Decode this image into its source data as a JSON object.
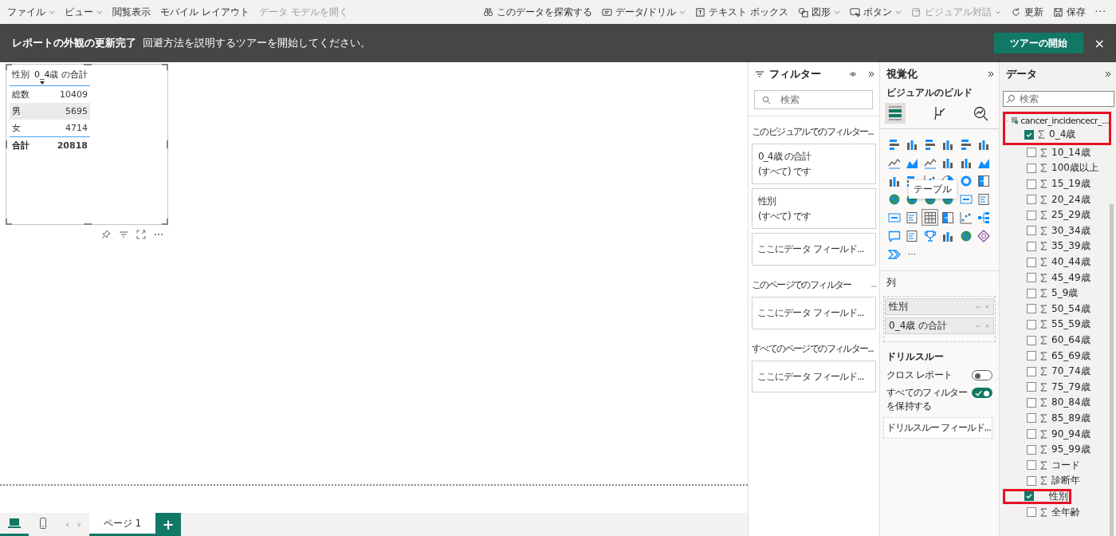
{
  "toolbar": {
    "left": [
      {
        "label": "ファイル",
        "dropdown": true,
        "disabled": false
      },
      {
        "label": "ビュー",
        "dropdown": true,
        "disabled": false
      },
      {
        "label": "閲覧表示",
        "dropdown": false,
        "disabled": false
      },
      {
        "label": "モバイル レイアウト",
        "dropdown": false,
        "disabled": false
      },
      {
        "label": "データ モデルを開く",
        "dropdown": false,
        "disabled": true
      }
    ],
    "right": [
      {
        "kind": "explore",
        "label": "このデータを探索する",
        "dropdown": false,
        "disabled": false
      },
      {
        "kind": "drill",
        "label": "データ/ドリル",
        "dropdown": true,
        "disabled": false
      },
      {
        "kind": "textbox",
        "label": "テキスト ボックス",
        "dropdown": false,
        "disabled": false
      },
      {
        "kind": "shapes",
        "label": "図形",
        "dropdown": true,
        "disabled": false
      },
      {
        "kind": "button",
        "label": "ボタン",
        "dropdown": true,
        "disabled": false
      },
      {
        "kind": "interact",
        "label": "ビジュアル対話",
        "dropdown": true,
        "disabled": true
      },
      {
        "kind": "refresh",
        "label": "更新",
        "dropdown": false,
        "disabled": false
      },
      {
        "kind": "save",
        "label": "保存",
        "dropdown": false,
        "disabled": false
      }
    ],
    "more": "···"
  },
  "banner": {
    "title": "レポートの外観の更新完了",
    "message": "回避方法を説明するツアーを開始してください。",
    "button": "ツアーの開始",
    "close": "×"
  },
  "table_visual": {
    "columns": [
      "性別",
      "0_4歳 の合計"
    ],
    "rows": [
      {
        "label": "総数",
        "value": "10409",
        "highlighted": false
      },
      {
        "label": "男",
        "value": "5695",
        "highlighted": true
      },
      {
        "label": "女",
        "value": "4714",
        "highlighted": false
      }
    ],
    "total": {
      "label": "合計",
      "value": "20818"
    }
  },
  "filters": {
    "title": "フィルター",
    "search_placeholder": "検索",
    "sections": [
      {
        "title": "このビジュアルでのフィルター...",
        "cards": [
          {
            "title": "0_4歳 の合計",
            "subtitle": "(すべて) です"
          },
          {
            "title": "性別",
            "subtitle": "(すべて) です"
          },
          {
            "placeholder": "ここにデータ フィールド..."
          }
        ]
      },
      {
        "title": "このページでのフィルター",
        "more": "...",
        "cards": [
          {
            "placeholder": "ここにデータ フィールド..."
          }
        ]
      },
      {
        "title": "すべてのページでのフィルター...",
        "cards": [
          {
            "placeholder": "ここにデータ フィールド..."
          }
        ]
      }
    ]
  },
  "visualizations": {
    "title": "視覚化",
    "subtitle": "ビジュアルのビルド",
    "modes": [
      {
        "kind": "build",
        "selected": true
      },
      {
        "kind": "format",
        "selected": false
      },
      {
        "kind": "analytics",
        "selected": false
      }
    ],
    "types": [
      {
        "kind": "stacked-bar",
        "selected": false
      },
      {
        "kind": "stacked-column",
        "selected": false
      },
      {
        "kind": "clustered-bar",
        "selected": false
      },
      {
        "kind": "clustered-column",
        "selected": false
      },
      {
        "kind": "percent-bar",
        "selected": false
      },
      {
        "kind": "percent-column",
        "selected": false
      },
      {
        "kind": "line",
        "selected": false
      },
      {
        "kind": "area",
        "selected": false
      },
      {
        "kind": "stacked-area",
        "selected": false
      },
      {
        "kind": "line-column",
        "selected": false
      },
      {
        "kind": "line-clustered",
        "selected": false
      },
      {
        "kind": "ribbon",
        "selected": false
      },
      {
        "kind": "waterfall",
        "selected": false
      },
      {
        "kind": "funnel",
        "selected": false
      },
      {
        "kind": "scatter",
        "selected": false
      },
      {
        "kind": "pie",
        "selected": false
      },
      {
        "kind": "donut",
        "selected": false
      },
      {
        "kind": "treemap",
        "selected": false
      },
      {
        "kind": "map",
        "selected": false
      },
      {
        "kind": "filled-map",
        "selected": false
      },
      {
        "kind": "shape-map",
        "selected": false
      },
      {
        "kind": "azure-map",
        "selected": false
      },
      {
        "kind": "card",
        "selected": false
      },
      {
        "kind": "multi-card",
        "selected": false
      },
      {
        "kind": "kpi",
        "selected": false
      },
      {
        "kind": "slicer",
        "selected": false
      },
      {
        "kind": "table",
        "selected": true
      },
      {
        "kind": "matrix",
        "selected": false
      },
      {
        "kind": "influencers",
        "selected": false
      },
      {
        "kind": "decomposition",
        "selected": false
      },
      {
        "kind": "qna",
        "selected": false
      },
      {
        "kind": "paginated",
        "selected": false
      },
      {
        "kind": "trophy",
        "selected": false
      },
      {
        "kind": "narrative",
        "selected": false
      },
      {
        "kind": "globe",
        "selected": false
      },
      {
        "kind": "apps",
        "selected": false
      },
      {
        "kind": "automate",
        "selected": false
      }
    ],
    "more": "···",
    "tooltip": "テーブル",
    "wells_label": "列",
    "wells": [
      "性別",
      "0_4歳 の合計"
    ],
    "drill_title": "ドリルスルー",
    "toggles": [
      {
        "label": "クロス レポート",
        "on": false
      },
      {
        "label": "すべてのフィルターを保持する",
        "on": true
      }
    ],
    "drill_placeholder": "ドリルスルー フィールド..."
  },
  "data": {
    "title": "データ",
    "search_placeholder": "検索",
    "table": {
      "name": "cancer_incidencecr_...",
      "highlighted": true,
      "expanded": true,
      "fields": [
        {
          "name": "0_4歳",
          "kind": "measure",
          "checked": true,
          "highlighted": false
        },
        {
          "name": "10_14歳",
          "kind": "measure",
          "checked": false,
          "highlighted": false
        },
        {
          "name": "100歳以上",
          "kind": "measure",
          "checked": false,
          "highlighted": false
        },
        {
          "name": "15_19歳",
          "kind": "measure",
          "checked": false,
          "highlighted": false
        },
        {
          "name": "20_24歳",
          "kind": "measure",
          "checked": false,
          "highlighted": false
        },
        {
          "name": "25_29歳",
          "kind": "measure",
          "checked": false,
          "highlighted": false
        },
        {
          "name": "30_34歳",
          "kind": "measure",
          "checked": false,
          "highlighted": false
        },
        {
          "name": "35_39歳",
          "kind": "measure",
          "checked": false,
          "highlighted": false
        },
        {
          "name": "40_44歳",
          "kind": "measure",
          "checked": false,
          "highlighted": false
        },
        {
          "name": "45_49歳",
          "kind": "measure",
          "checked": false,
          "highlighted": false
        },
        {
          "name": "5_9歳",
          "kind": "measure",
          "checked": false,
          "highlighted": false
        },
        {
          "name": "50_54歳",
          "kind": "measure",
          "checked": false,
          "highlighted": false
        },
        {
          "name": "55_59歳",
          "kind": "measure",
          "checked": false,
          "highlighted": false
        },
        {
          "name": "60_64歳",
          "kind": "measure",
          "checked": false,
          "highlighted": false
        },
        {
          "name": "65_69歳",
          "kind": "measure",
          "checked": false,
          "highlighted": false
        },
        {
          "name": "70_74歳",
          "kind": "measure",
          "checked": false,
          "highlighted": false
        },
        {
          "name": "75_79歳",
          "kind": "measure",
          "checked": false,
          "highlighted": false
        },
        {
          "name": "80_84歳",
          "kind": "measure",
          "checked": false,
          "highlighted": false
        },
        {
          "name": "85_89歳",
          "kind": "measure",
          "checked": false,
          "highlighted": false
        },
        {
          "name": "90_94歳",
          "kind": "measure",
          "checked": false,
          "highlighted": false
        },
        {
          "name": "95_99歳",
          "kind": "measure",
          "checked": false,
          "highlighted": false
        },
        {
          "name": "コード",
          "kind": "measure",
          "checked": false,
          "highlighted": false
        },
        {
          "name": "診断年",
          "kind": "measure",
          "checked": false,
          "highlighted": false
        },
        {
          "name": "性別",
          "kind": "text",
          "checked": true,
          "highlighted": true
        },
        {
          "name": "全年齢",
          "kind": "measure",
          "checked": false,
          "highlighted": false
        }
      ]
    }
  },
  "bottom": {
    "views": [
      {
        "kind": "desktop",
        "selected": true
      },
      {
        "kind": "phone",
        "selected": false
      }
    ],
    "pages": [
      {
        "label": "ページ 1",
        "selected": true
      }
    ],
    "add": "+"
  }
}
